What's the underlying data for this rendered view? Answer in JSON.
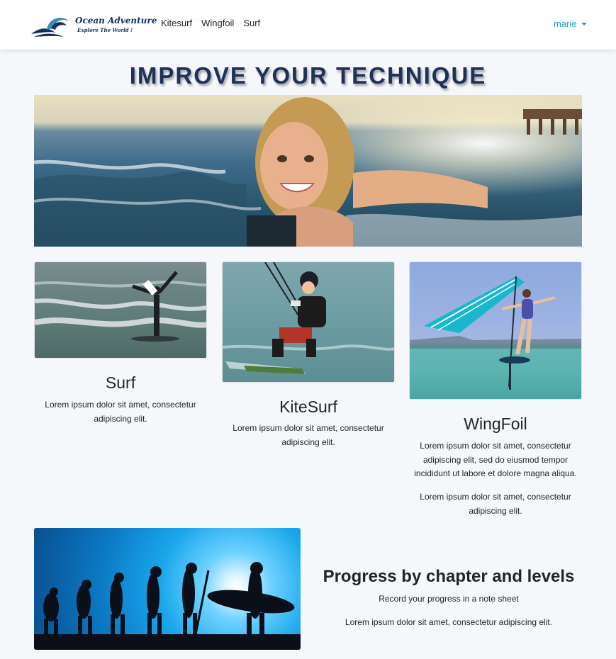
{
  "navbar": {
    "brand_name": "Ocean Adventure",
    "brand_tagline": "Explore The World !",
    "links": [
      "Kitesurf",
      "Wingfoil",
      "Surf"
    ],
    "user": "marie"
  },
  "hero": {
    "title": "IMPROVE YOUR TECHNIQUE"
  },
  "cards": [
    {
      "title": "Surf",
      "paragraphs": [
        "Lorem ipsum dolor sit amet, consectetur adipiscing elit."
      ]
    },
    {
      "title": "KiteSurf",
      "paragraphs": [
        "Lorem ipsum dolor sit amet, consectetur adipiscing elit."
      ]
    },
    {
      "title": "WingFoil",
      "paragraphs": [
        "Lorem ipsum dolor sit amet, consectetur adipiscing elit, sed do eiusmod tempor incididunt ut labore et dolore magna aliqua.",
        "Lorem ipsum dolor sit amet, consectetur adipiscing elit."
      ]
    }
  ],
  "progress": {
    "title": "Progress by chapter and levels",
    "subtitle": "Record your progress in a note sheet",
    "text": "Lorem ipsum dolor sit amet, consectetur adipiscing elit."
  },
  "colors": {
    "nav_accent": "#17a2b8",
    "title_navy": "#1e3158",
    "page_bg": "#f5f7fa"
  }
}
